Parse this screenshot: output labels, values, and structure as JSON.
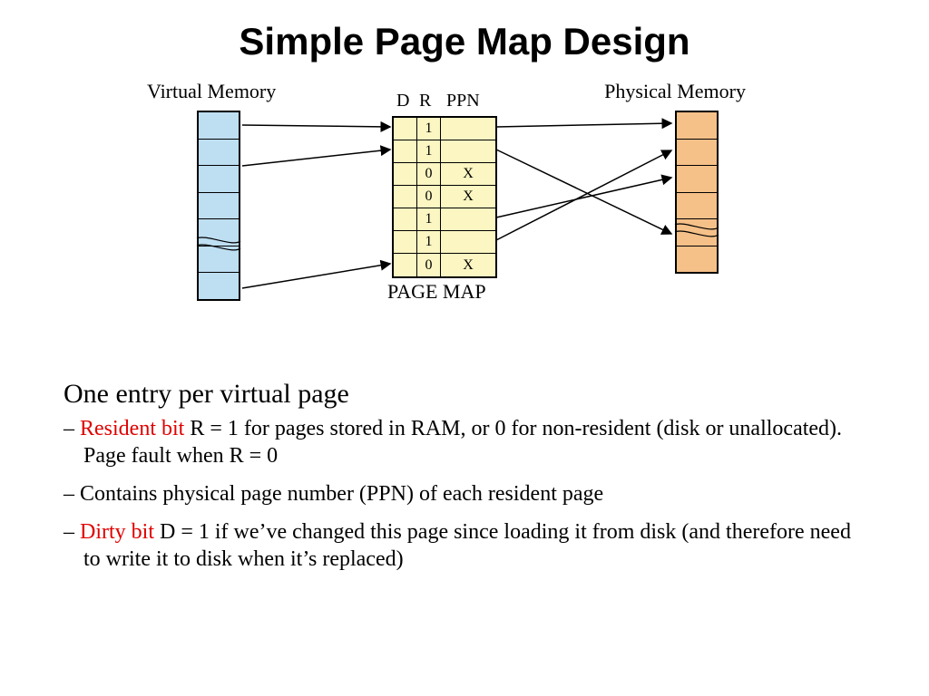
{
  "title": "Simple Page Map Design",
  "diagram": {
    "vm_label": "Virtual Memory",
    "pm_label": "Physical Memory",
    "pagemap_label": "PAGE MAP",
    "cols": {
      "D": "D",
      "R": "R",
      "PPN": "PPN"
    },
    "rows": [
      {
        "D": "",
        "R": "1",
        "PPN": ""
      },
      {
        "D": "",
        "R": "1",
        "PPN": ""
      },
      {
        "D": "",
        "R": "0",
        "PPN": "X"
      },
      {
        "D": "",
        "R": "0",
        "PPN": "X"
      },
      {
        "D": "",
        "R": "1",
        "PPN": ""
      },
      {
        "D": "",
        "R": "1",
        "PPN": ""
      },
      {
        "D": "",
        "R": "0",
        "PPN": "X"
      }
    ]
  },
  "heading2": "One entry per virtual page",
  "bullets": {
    "b1_red": "Resident bit",
    "b1_rest": " R = 1 for pages stored in RAM, or 0 for non-resident (disk or unallocated). Page fault when R = 0",
    "b2": "Contains physical page number (PPN) of each resident page",
    "b3_red": "Dirty bit",
    "b3_rest": " D = 1 if we’ve changed this page since loading it from disk (and therefore need to write it to disk when it’s replaced)"
  }
}
